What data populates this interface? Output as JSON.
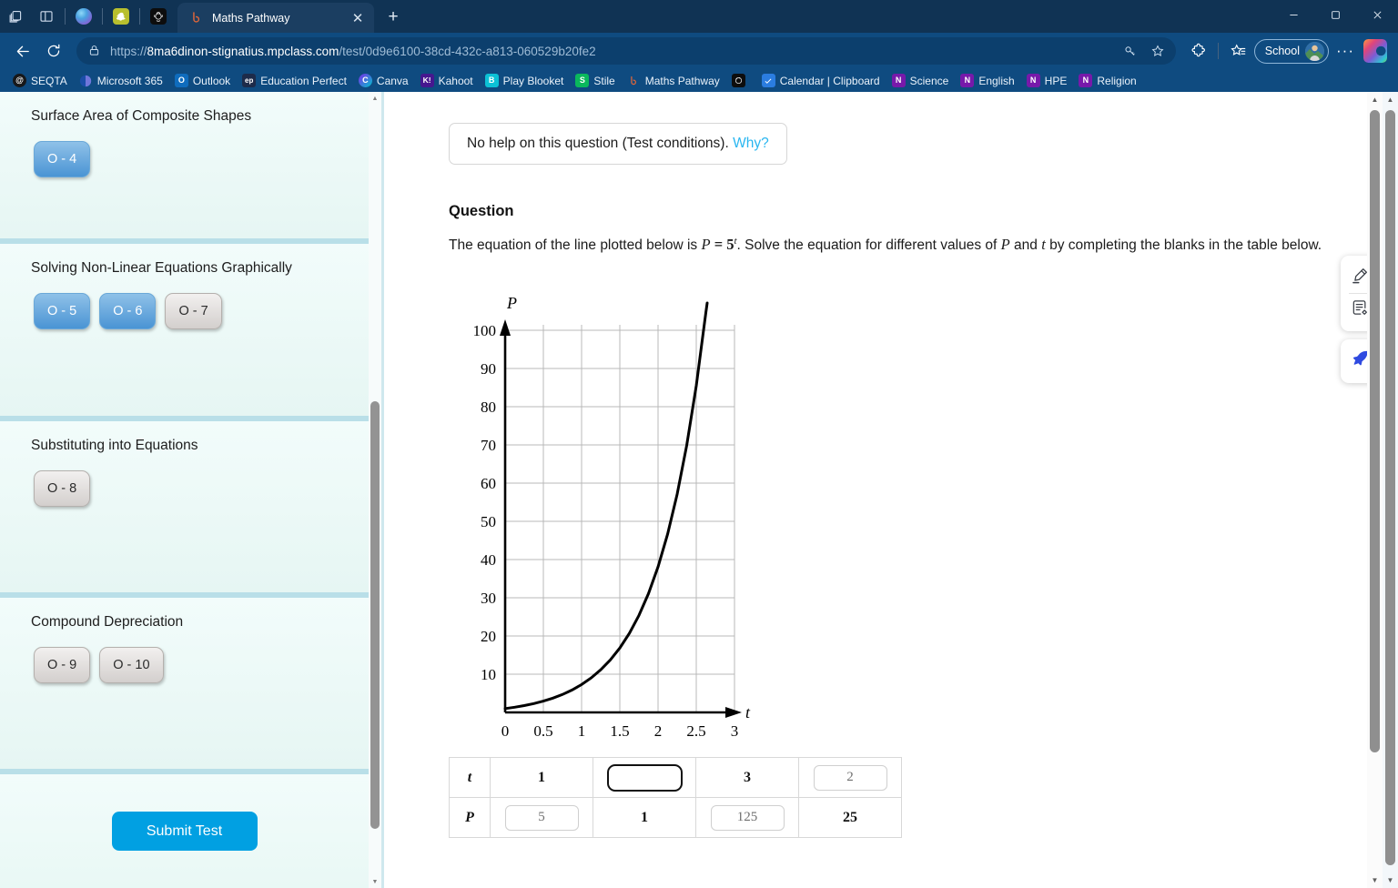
{
  "browser": {
    "tab": {
      "title": "Maths Pathway",
      "favicon": "maths-pathway-icon",
      "close": "✕"
    },
    "new_tab_label": "+",
    "window_controls": {
      "minimize": "─",
      "maximize": "❐",
      "close": "✕"
    },
    "toolbar_icons": {
      "tab_groups": "tab-groups-icon",
      "split_screen": "split-screen-icon",
      "back": "←",
      "refresh": "↻",
      "lock": "lock-icon",
      "key": "key-icon",
      "favorite": "☆",
      "extensions": "puzzle-icon",
      "collections": "collections-icon",
      "more": "···",
      "copilot": "copilot-icon"
    },
    "pinned_tabs": [
      {
        "name": "copilot-pinned-tab",
        "label": ""
      },
      {
        "name": "snapchat-pinned-tab",
        "label": ""
      },
      {
        "name": "chatgpt-pinned-tab",
        "label": ""
      }
    ],
    "url": {
      "scheme": "https://",
      "host": "8ma6dinon-stignatius.mpclass.com",
      "path": "/test/0d9e6100-38cd-432c-a813-060529b20fe2",
      "full": "https://8ma6dinon-stignatius.mpclass.com/test/0d9e6100-38cd-432c-a813-060529b20fe2"
    },
    "profile": {
      "label": "School"
    },
    "bookmarks": [
      {
        "label": "SEQTA",
        "icon": "@",
        "bg": "#17181a",
        "fg": "#ffffff"
      },
      {
        "label": "Microsoft 365",
        "icon": "",
        "bg": "#1b3f8f",
        "fg": "#ffffff"
      },
      {
        "label": "Outlook",
        "icon": "O",
        "bg": "#0f6cbd",
        "fg": "#ffffff"
      },
      {
        "label": "Education Perfect",
        "icon": "ep",
        "bg": "#1d2b4a",
        "fg": "#ffffff"
      },
      {
        "label": "Canva",
        "icon": "C",
        "bg": "#7d2ae8",
        "fg": "#ffffff"
      },
      {
        "label": "Kahoot",
        "icon": "K!",
        "bg": "#46178f",
        "fg": "#ffffff"
      },
      {
        "label": "Play Blooket",
        "icon": "B",
        "bg": "#0cc1d6",
        "fg": "#ffffff"
      },
      {
        "label": "Stile",
        "icon": "S",
        "bg": "#0ab85c",
        "fg": "#ffffff"
      },
      {
        "label": "Maths Pathway",
        "icon": "ψ",
        "bg": "#0f4b80",
        "fg": "#e0663a"
      },
      {
        "label": "",
        "icon": "",
        "bg": "#0d0d0d",
        "fg": "#ffffff"
      },
      {
        "label": "Calendar | Clipboard",
        "icon": "✓",
        "bg": "#2b7de0",
        "fg": "#ffffff"
      },
      {
        "label": "Science",
        "icon": "N",
        "bg": "#7719aa",
        "fg": "#ffffff"
      },
      {
        "label": "English",
        "icon": "N",
        "bg": "#7719aa",
        "fg": "#ffffff"
      },
      {
        "label": "HPE",
        "icon": "N",
        "bg": "#7719aa",
        "fg": "#ffffff"
      },
      {
        "label": "Religion",
        "icon": "N",
        "bg": "#7719aa",
        "fg": "#ffffff"
      }
    ]
  },
  "sidebar": {
    "topics": [
      {
        "title": "Surface Area of Composite Shapes",
        "chips": [
          {
            "label": "O - 4",
            "state": "blue"
          }
        ]
      },
      {
        "title": "Solving Non-Linear Equations Graphically",
        "chips": [
          {
            "label": "O - 5",
            "state": "blue"
          },
          {
            "label": "O - 6",
            "state": "blue"
          },
          {
            "label": "O - 7",
            "state": "grey"
          }
        ]
      },
      {
        "title": "Substituting into Equations",
        "chips": [
          {
            "label": "O - 8",
            "state": "grey"
          }
        ]
      },
      {
        "title": "Compound Depreciation",
        "chips": [
          {
            "label": "O - 9",
            "state": "grey"
          },
          {
            "label": "O - 10",
            "state": "grey"
          }
        ]
      }
    ],
    "submit_label": "Submit Test"
  },
  "main": {
    "help_notice": {
      "text": "No help on this question (Test conditions).",
      "link": "Why?"
    },
    "question_heading": "Question",
    "question_text_1": "The equation of the line plotted below is ",
    "question_eq_P": "P",
    "question_eq_eq": " = ",
    "question_eq_base": "5",
    "question_eq_exp": "t",
    "question_text_2": ". Solve the equation for different values of ",
    "question_var_P": "P",
    "question_text_3": " and ",
    "question_var_t": "t",
    "question_text_4": " by completing the blanks in the table below.",
    "tools": [
      {
        "name": "annotate-pen-icon"
      },
      {
        "name": "scratchpad-icon"
      },
      {
        "name": "rocket-icon"
      }
    ]
  },
  "table": {
    "rows": [
      {
        "label": "t",
        "cells": [
          {
            "type": "static",
            "value": "1"
          },
          {
            "type": "input",
            "value": "",
            "focused": true
          },
          {
            "type": "static",
            "value": "3"
          },
          {
            "type": "input",
            "value": "2",
            "focused": false
          }
        ]
      },
      {
        "label": "P",
        "cells": [
          {
            "type": "input",
            "value": "5",
            "focused": false
          },
          {
            "type": "static",
            "value": "1"
          },
          {
            "type": "input",
            "value": "125",
            "focused": false
          },
          {
            "type": "static",
            "value": "25"
          }
        ]
      }
    ]
  },
  "chart_data": {
    "type": "line",
    "title": "",
    "xlabel": "t",
    "ylabel": "P",
    "xlim": [
      0,
      3
    ],
    "ylim": [
      0,
      100
    ],
    "xticks": [
      "0",
      "0.5",
      "1",
      "1.5",
      "2",
      "2.5",
      "3"
    ],
    "xtick_values": [
      0,
      0.5,
      1,
      1.5,
      2,
      2.5,
      3
    ],
    "yticks": [
      "10",
      "20",
      "30",
      "40",
      "50",
      "60",
      "70",
      "80",
      "90",
      "100"
    ],
    "ytick_values": [
      10,
      20,
      30,
      40,
      50,
      60,
      70,
      80,
      90,
      100
    ],
    "grid": true,
    "legend": "none",
    "equation": "P = 5^t",
    "series": [
      {
        "name": "P = 5^t",
        "color": "#000000",
        "x": [
          0,
          0.25,
          0.5,
          0.75,
          1,
          1.25,
          1.5,
          1.75,
          2,
          2.25,
          2.5,
          2.75,
          2.86
        ],
        "y": [
          1,
          1.5,
          2.24,
          3.34,
          5,
          7.48,
          11.18,
          16.72,
          25,
          37.38,
          55.9,
          83.59,
          100
        ]
      }
    ]
  }
}
